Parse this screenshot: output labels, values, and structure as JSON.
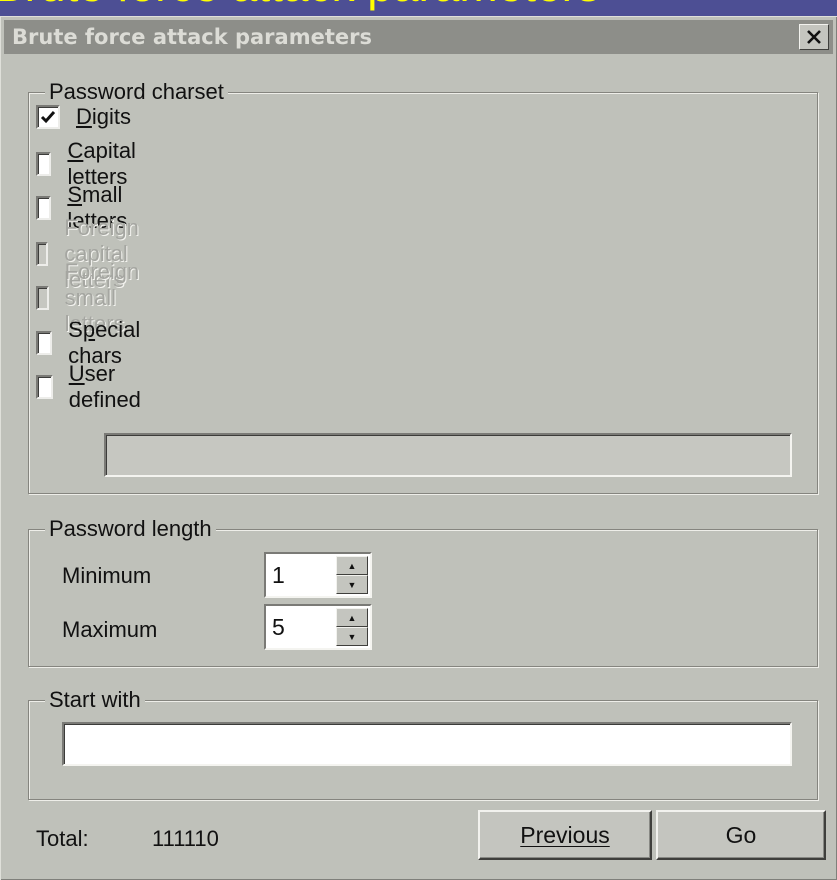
{
  "slide": {
    "title": "Brute force attack parameters"
  },
  "dialog": {
    "title": "Brute force attack parameters",
    "close_label": "✕"
  },
  "charset": {
    "legend": "Password charset",
    "options": [
      {
        "label": "Digits",
        "accel": "D",
        "checked": true,
        "disabled": false
      },
      {
        "label": "Capital letters",
        "accel": "C",
        "checked": false,
        "disabled": false
      },
      {
        "label": "Small letters",
        "accel": "S",
        "checked": false,
        "disabled": false
      },
      {
        "label": "Foreign capital letters",
        "accel": "",
        "checked": false,
        "disabled": true
      },
      {
        "label": "Foreign small letters",
        "accel": "",
        "checked": false,
        "disabled": true
      },
      {
        "label": "Special chars",
        "accel": "p",
        "checked": false,
        "disabled": false
      },
      {
        "label": "User defined",
        "accel": "U",
        "checked": false,
        "disabled": false
      }
    ],
    "user_defined_value": ""
  },
  "length": {
    "legend": "Password length",
    "minimum_label": "Minimum",
    "minimum_value": "1",
    "maximum_label": "Maximum",
    "maximum_value": "5"
  },
  "start": {
    "legend": "Start with",
    "value": ""
  },
  "footer": {
    "total_label": "Total:",
    "total_value": "111110",
    "previous_label": "Previous",
    "go_label": "Go"
  }
}
